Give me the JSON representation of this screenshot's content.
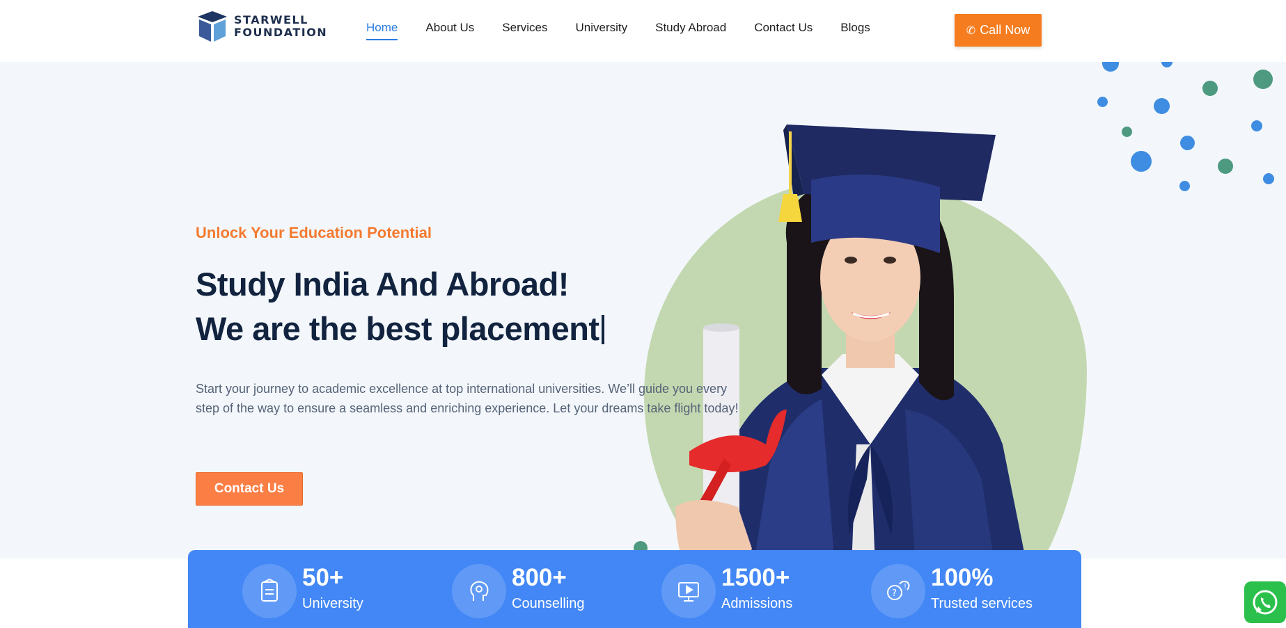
{
  "brand": {
    "line1": "STARWELL",
    "line2": "FOUNDATION"
  },
  "nav": [
    {
      "label": "Home",
      "active": true
    },
    {
      "label": "About Us"
    },
    {
      "label": "Services"
    },
    {
      "label": "University"
    },
    {
      "label": "Study Abroad"
    },
    {
      "label": "Contact Us"
    },
    {
      "label": "Blogs"
    }
  ],
  "call_button": {
    "label": "Call Now",
    "icon": "phone-icon"
  },
  "hero": {
    "tagline": "Unlock Your Education Potential",
    "headline_line1": "Study India And Abroad!",
    "headline_line2": "We are the best placement",
    "description": "Start your journey to academic excellence at top international universities. We’ll guide you every step of the way to ensure a seamless and enriching experience. Let your dreams take flight today!",
    "cta": "Contact Us"
  },
  "stats": [
    {
      "value": "50+",
      "label": "University",
      "icon": "book-icon"
    },
    {
      "value": "800+",
      "label": "Counselling",
      "icon": "head-icon"
    },
    {
      "value": "1500+",
      "label": "Admissions",
      "icon": "monitor-icon"
    },
    {
      "value": "100%",
      "label": "Trusted services",
      "icon": "question-bubble-icon"
    }
  ],
  "colors": {
    "accent": "#f57c1f",
    "primary_blue": "#4287f5",
    "navy": "#12233f",
    "blob_green": "#c3d8b0"
  },
  "whatsapp": {
    "icon": "whatsapp-icon"
  }
}
